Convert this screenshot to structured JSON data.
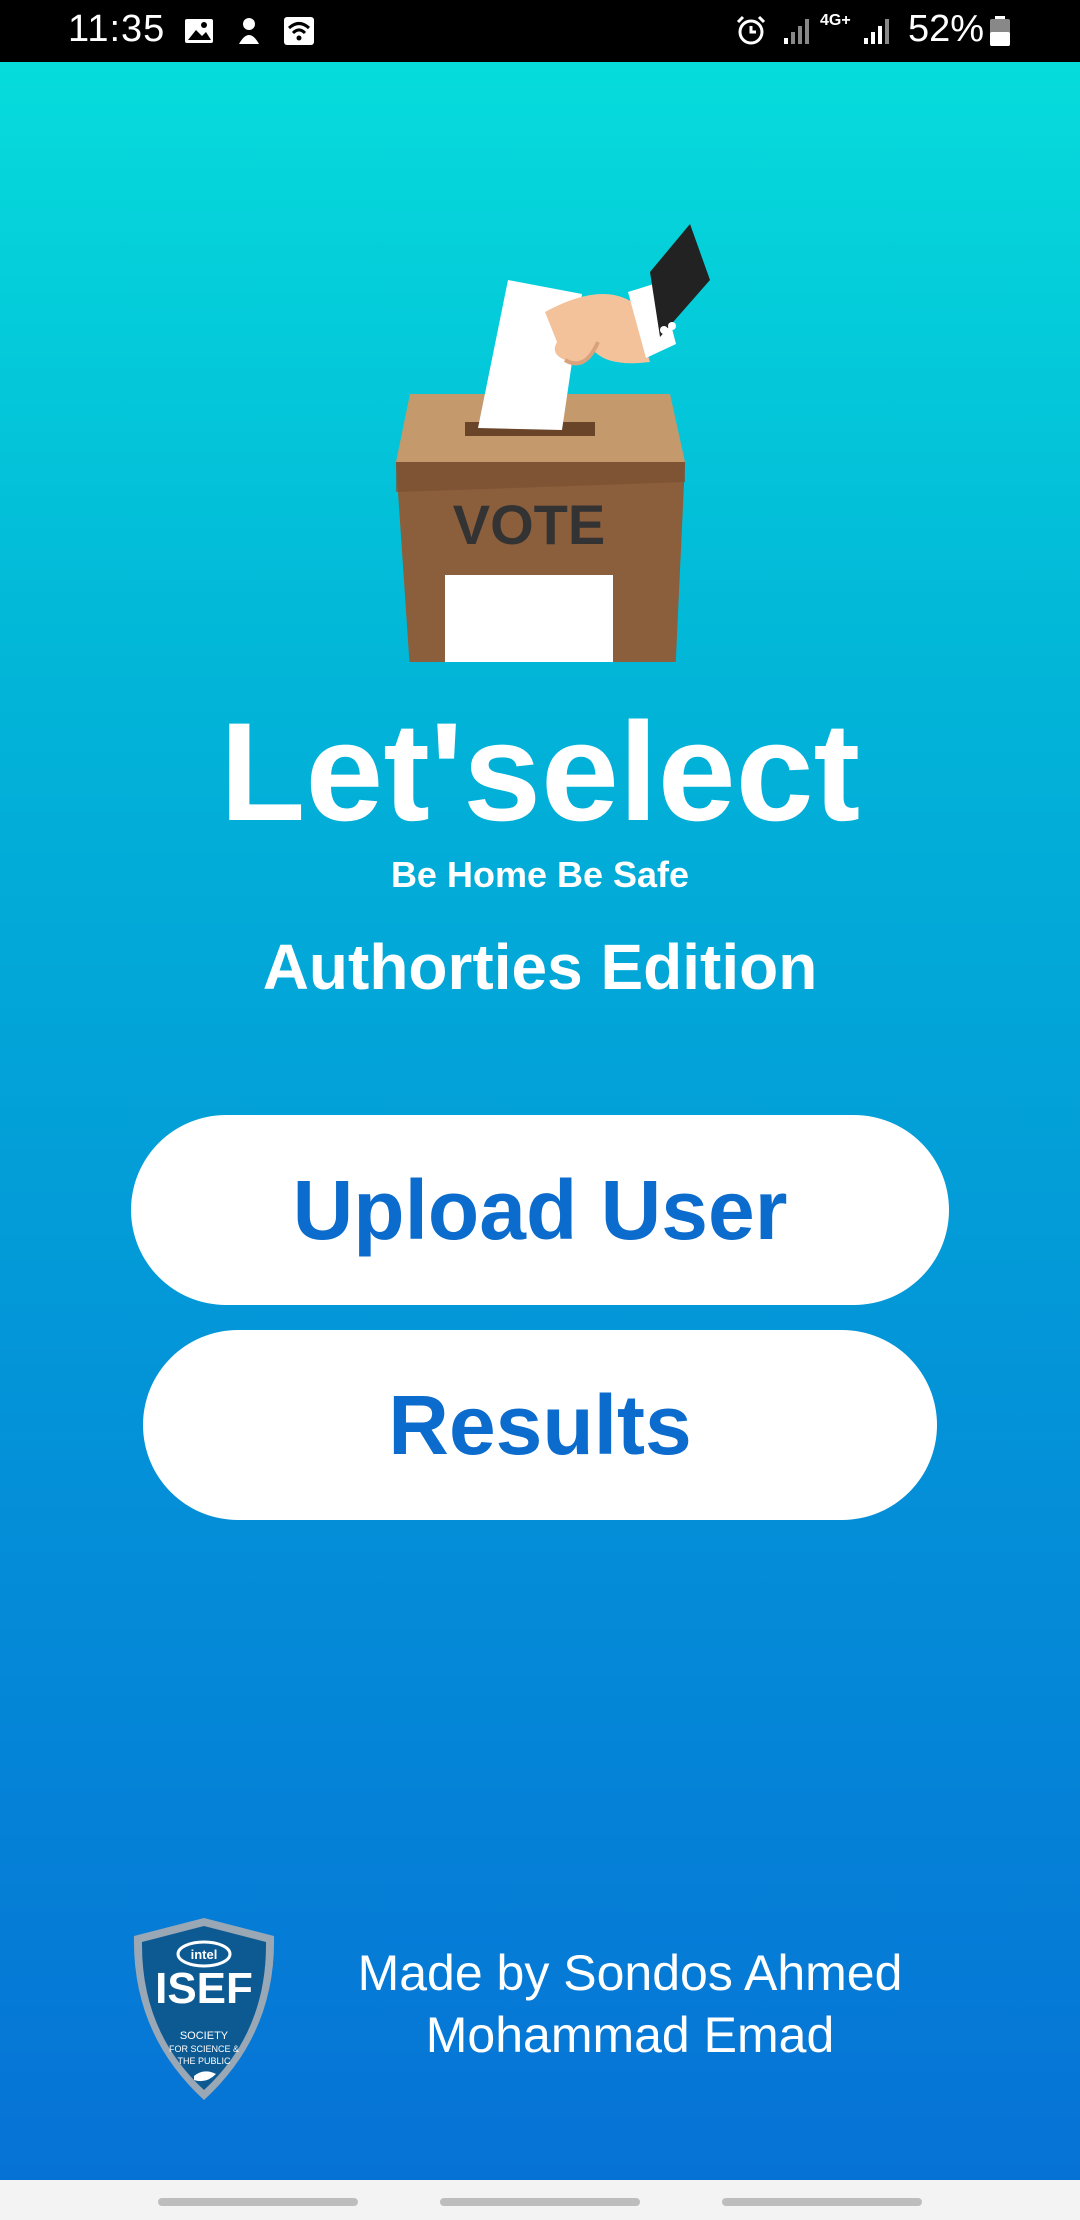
{
  "status_bar": {
    "time": "11:35",
    "network": "4G+",
    "battery": "52%",
    "icons": [
      "image-icon",
      "notification-icon",
      "wifi-icon",
      "alarm-icon",
      "signal-icon",
      "signal-icon",
      "battery-icon"
    ]
  },
  "hero": {
    "illustration": "ballot-box-icon",
    "ballot_label": "VOTE"
  },
  "app": {
    "title": "Let'select",
    "tagline": "Be Home Be Safe",
    "edition": "Authorties Edition"
  },
  "actions": {
    "upload_user": "Upload User",
    "results": "Results"
  },
  "footer": {
    "logo": "isef-logo",
    "logo_text": "ISEF",
    "credit_line1": "Made by Sondos Ahmed",
    "credit_line2": "Mohammad Emad"
  },
  "colors": {
    "gradient_top": "#06dcdb",
    "gradient_bottom": "#0672d6",
    "button_text": "#0b6ccd",
    "button_bg": "#ffffff",
    "box_brown": "#8b5e3c"
  }
}
